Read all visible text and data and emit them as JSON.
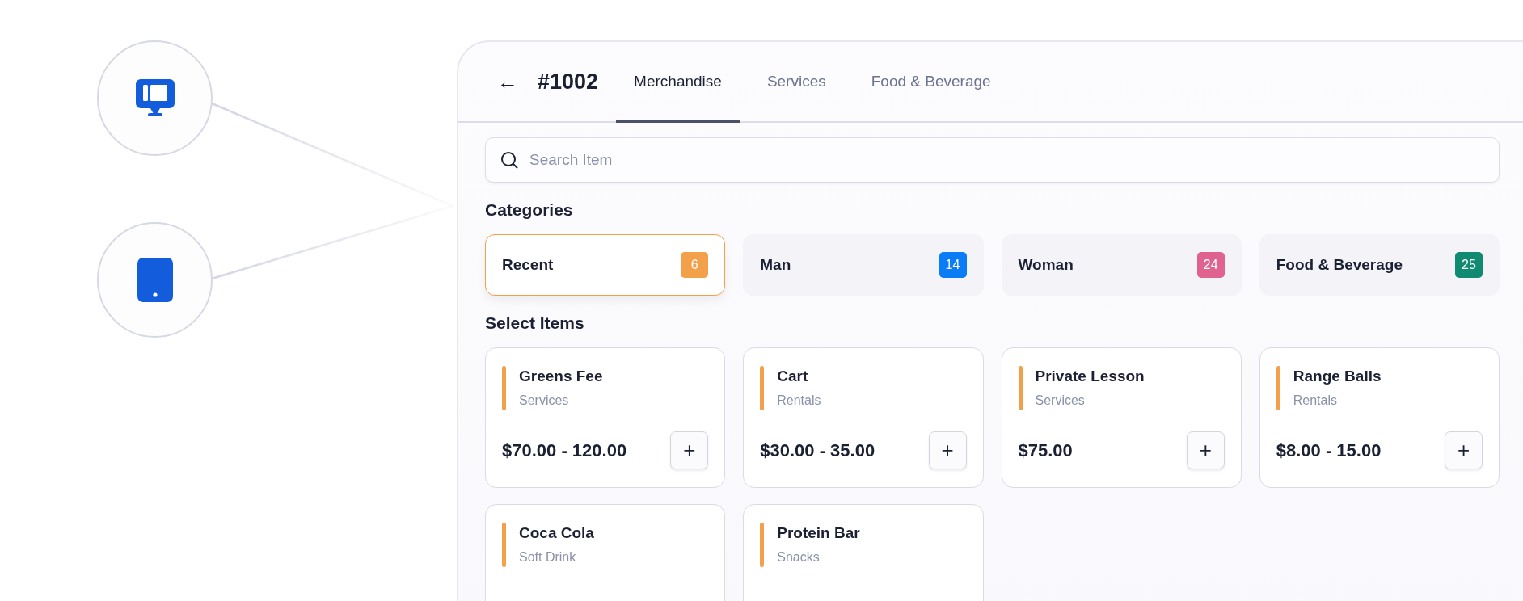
{
  "devices": [
    {
      "kind": "monitor"
    },
    {
      "kind": "tablet"
    }
  ],
  "order": {
    "back": "←",
    "number": "#1002"
  },
  "tabs": [
    {
      "label": "Merchandise",
      "selected": true
    },
    {
      "label": "Services",
      "selected": false
    },
    {
      "label": "Food & Beverage",
      "selected": false
    }
  ],
  "search": {
    "placeholder": "Search Item"
  },
  "categories_title": "Categories",
  "categories": [
    {
      "name": "Recent",
      "count": "6",
      "color": "#f2a04a",
      "selected": true
    },
    {
      "name": "Man",
      "count": "14",
      "color": "#0a7cf5",
      "selected": false
    },
    {
      "name": "Woman",
      "count": "24",
      "color": "#e0628e",
      "selected": false
    },
    {
      "name": "Food & Beverage",
      "count": "25",
      "color": "#108a70",
      "selected": false
    }
  ],
  "items_title": "Select Items",
  "items": [
    {
      "name": "Greens Fee",
      "category": "Services",
      "price": "$70.00 - 120.00",
      "add": "+"
    },
    {
      "name": "Cart",
      "category": "Rentals",
      "price": "$30.00 - 35.00",
      "add": "+"
    },
    {
      "name": "Private Lesson",
      "category": "Services",
      "price": "$75.00",
      "add": "+"
    },
    {
      "name": "Range Balls",
      "category": "Rentals",
      "price": "$8.00 - 15.00",
      "add": "+"
    },
    {
      "name": "Coca Cola",
      "category": "Soft Drink"
    },
    {
      "name": "Protein Bar",
      "category": "Snacks"
    }
  ]
}
